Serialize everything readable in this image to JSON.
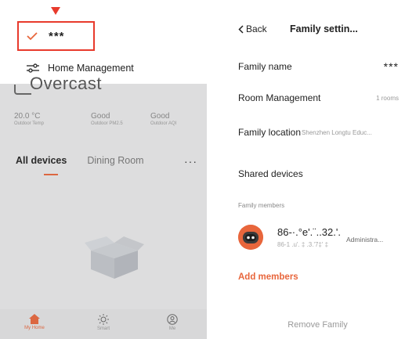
{
  "left": {
    "family_selector": {
      "name": "***"
    },
    "home_management_label": "Home Management",
    "weather": {
      "condition": "Overcast",
      "stats": [
        {
          "value": "20.0 °C",
          "label": "Outdoor Temp"
        },
        {
          "value": "Good",
          "label": "Outdoor PM2.5"
        },
        {
          "value": "Good",
          "label": "Outdoor AQI"
        }
      ]
    },
    "tabs": {
      "all": "All devices",
      "dining": "Dining Room",
      "more": "···"
    },
    "bottom_nav": [
      {
        "label": "My Home",
        "icon": "home-icon",
        "active": true
      },
      {
        "label": "Smart",
        "icon": "sun-icon",
        "active": false
      },
      {
        "label": "Me",
        "icon": "user-icon",
        "active": false
      }
    ]
  },
  "right": {
    "back_label": "Back",
    "title": "Family settin...",
    "family_name": {
      "label": "Family name",
      "value": "***"
    },
    "room_management": {
      "label": "Room Management",
      "value": "1 rooms"
    },
    "family_location": {
      "label": "Family location",
      "value": "Shenzhen Longtu Educ..."
    },
    "shared_devices": {
      "label": "Shared devices"
    },
    "members_header": "Family members",
    "member": {
      "name": "86-·.°e'.¨..32.'.",
      "sub": "86-1 .u'. ‡ .3.'7‡' ‡",
      "role": "Administra..."
    },
    "add_members": "Add members",
    "remove_family": "Remove Family"
  },
  "colors": {
    "accent": "#e8663c",
    "highlight": "#e83a2c"
  }
}
